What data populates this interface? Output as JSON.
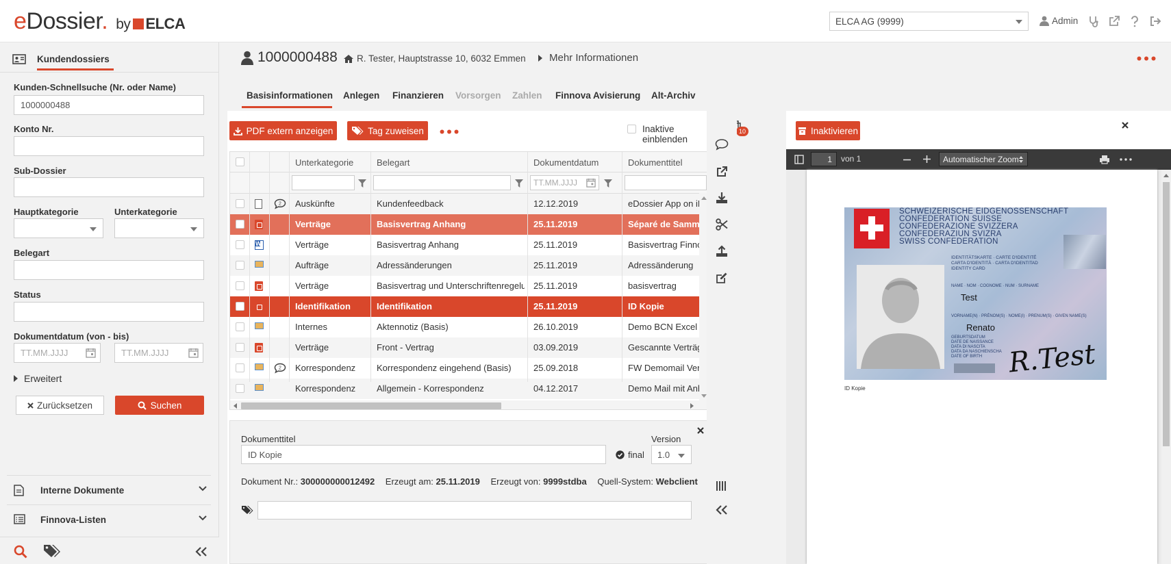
{
  "app": {
    "logo_e": "e",
    "logo_rest": "Dossier",
    "logo_dot": ".",
    "logo_by": "by",
    "logo_elca": "ELCA"
  },
  "header": {
    "mandant": "ELCA AG (9999)",
    "user": "Admin"
  },
  "sidebar": {
    "tab_label": "Kundendossiers",
    "fields": {
      "quick_search_label": "Kunden-Schnellsuche (Nr. oder Name)",
      "quick_search_value": "1000000488",
      "konto_label": "Konto Nr.",
      "subdossier_label": "Sub-Dossier",
      "hauptkategorie_label": "Hauptkategorie",
      "unterkategorie_label": "Unterkategorie",
      "belegart_label": "Belegart",
      "status_label": "Status",
      "datum_label": "Dokumentdatum (von - bis)",
      "date_placeholder": "TT.MM.JJJJ"
    },
    "erweitert": "Erweitert",
    "reset": "Zurücksetzen",
    "search": "Suchen",
    "accordion": [
      {
        "label": "Interne Dokumente"
      },
      {
        "label": "Finnova-Listen"
      }
    ]
  },
  "dossier": {
    "number": "1000000488",
    "address": "R. Tester, Hauptstrasse 10, 6032 Emmen",
    "more": "Mehr Informationen"
  },
  "tabs": [
    "Basisinformationen",
    "Anlegen",
    "Finanzieren",
    "Vorsorgen",
    "Zahlen",
    "Finnova Avisierung",
    "Alt-Archiv"
  ],
  "toolbar": {
    "pdf": "PDF extern anzeigen",
    "tag": "Tag zuweisen",
    "inactive": "Inaktive einblenden",
    "badge": "10"
  },
  "grid": {
    "columns": [
      "Unterkategorie",
      "Belegart",
      "Dokumentdatum",
      "Dokumenttitel"
    ],
    "date_filter_placeholder": "TT.MM.JJJJ",
    "rows": [
      {
        "icon": "doc",
        "comment": true,
        "unterkategorie": "Auskünfte",
        "belegart": "Kundenfeedback",
        "datum": "12.12.2019",
        "titel": "eDossier App on iPad",
        "state": "alt"
      },
      {
        "icon": "pdf",
        "comment": false,
        "unterkategorie": "Verträge",
        "belegart": "Basisvertrag Anhang",
        "datum": "25.11.2019",
        "titel": "Séparé de Sammelvertrag",
        "state": "sel"
      },
      {
        "icon": "word",
        "comment": false,
        "unterkategorie": "Verträge",
        "belegart": "Basisvertrag Anhang",
        "datum": "25.11.2019",
        "titel": "Basisvertrag Finnova",
        "state": ""
      },
      {
        "icon": "mail",
        "comment": false,
        "unterkategorie": "Aufträge",
        "belegart": "Adressänderungen",
        "datum": "25.11.2019",
        "titel": "Adressänderung",
        "state": "alt"
      },
      {
        "icon": "pdf",
        "comment": false,
        "unterkategorie": "Verträge",
        "belegart": "Basisvertrag und Unterschriftenregelung",
        "datum": "25.11.2019",
        "titel": "basisvertrag",
        "state": ""
      },
      {
        "icon": "pdf",
        "comment": false,
        "unterkategorie": "Identifikation",
        "belegart": "Identifikation",
        "datum": "25.11.2019",
        "titel": "ID Kopie",
        "state": "sel2"
      },
      {
        "icon": "mail",
        "comment": false,
        "unterkategorie": "Internes",
        "belegart": "Aktennotiz (Basis)",
        "datum": "26.10.2019",
        "titel": "Demo BCN Excel in",
        "state": ""
      },
      {
        "icon": "pdf",
        "comment": false,
        "unterkategorie": "Verträge",
        "belegart": "Front - Vertrag",
        "datum": "03.09.2019",
        "titel": "Gescannte Verträge",
        "state": "alt"
      },
      {
        "icon": "mail",
        "comment": true,
        "unterkategorie": "Korrespondenz",
        "belegart": "Korrespondenz eingehend (Basis)",
        "datum": "25.09.2018",
        "titel": "FW Demomail Vertrag",
        "state": ""
      },
      {
        "icon": "mail",
        "comment": false,
        "unterkategorie": "Korrespondenz",
        "belegart": "Allgemein - Korrespondenz",
        "datum": "04.12.2017",
        "titel": "Demo Mail mit Anhang",
        "state": "alt"
      }
    ]
  },
  "detail": {
    "titel_label": "Dokumenttitel",
    "titel_value": "ID Kopie",
    "final_label": "final",
    "version_label": "Version",
    "version_value": "1.0",
    "docnr_label": "Dokument Nr.:",
    "docnr_value": "300000000012492",
    "erzeugt_am_label": "Erzeugt am:",
    "erzeugt_am_value": "25.11.2019",
    "erzeugt_von_label": "Erzeugt von:",
    "erzeugt_von_value": "9999stdba",
    "quelle_label": "Quell-System:",
    "quelle_value": "Webclient"
  },
  "viewer": {
    "inactivate": "Inaktivieren",
    "page": "1",
    "page_of": "von 1",
    "zoom": "Automatischer Zoom",
    "caption": "ID Kopie",
    "id_card": {
      "header_lines": [
        "SCHWEIZERISCHE EIDGENOSSENSCHAFT",
        "CONFEDERATION SUISSE",
        "CONFEDERAZIONE SVIZZERA",
        "CONFEDERAZIUN SVIZRA",
        "SWISS CONFEDERATION"
      ],
      "card_title_lines": [
        "IDENTITÄTSKARTE · CARTE D'IDENTITÉ",
        "CARTA D'IDENTITÀ · CARTA D'IDENTITAD",
        "IDENTITY CARD"
      ],
      "name_label": "NAME · NOM · COGNOME · NUM · SURNAME",
      "name": "Test",
      "vorname_label": "VORNAME(N) · PRÉNOM(S) · NOME(I) · PRENUM(S) · GIVEN NAME(S)",
      "vorname": "Renato",
      "geburt_lines": [
        "GEBURTSDATUM",
        "DATE DE NAISSANCE",
        "DATA DI NASCITA",
        "DATA DA NASCHIENSCHA",
        "DATE OF BIRTH"
      ],
      "signature": "R.Test"
    }
  },
  "colors": {
    "accent": "#d9472b",
    "selected_row": "#e2705a"
  }
}
